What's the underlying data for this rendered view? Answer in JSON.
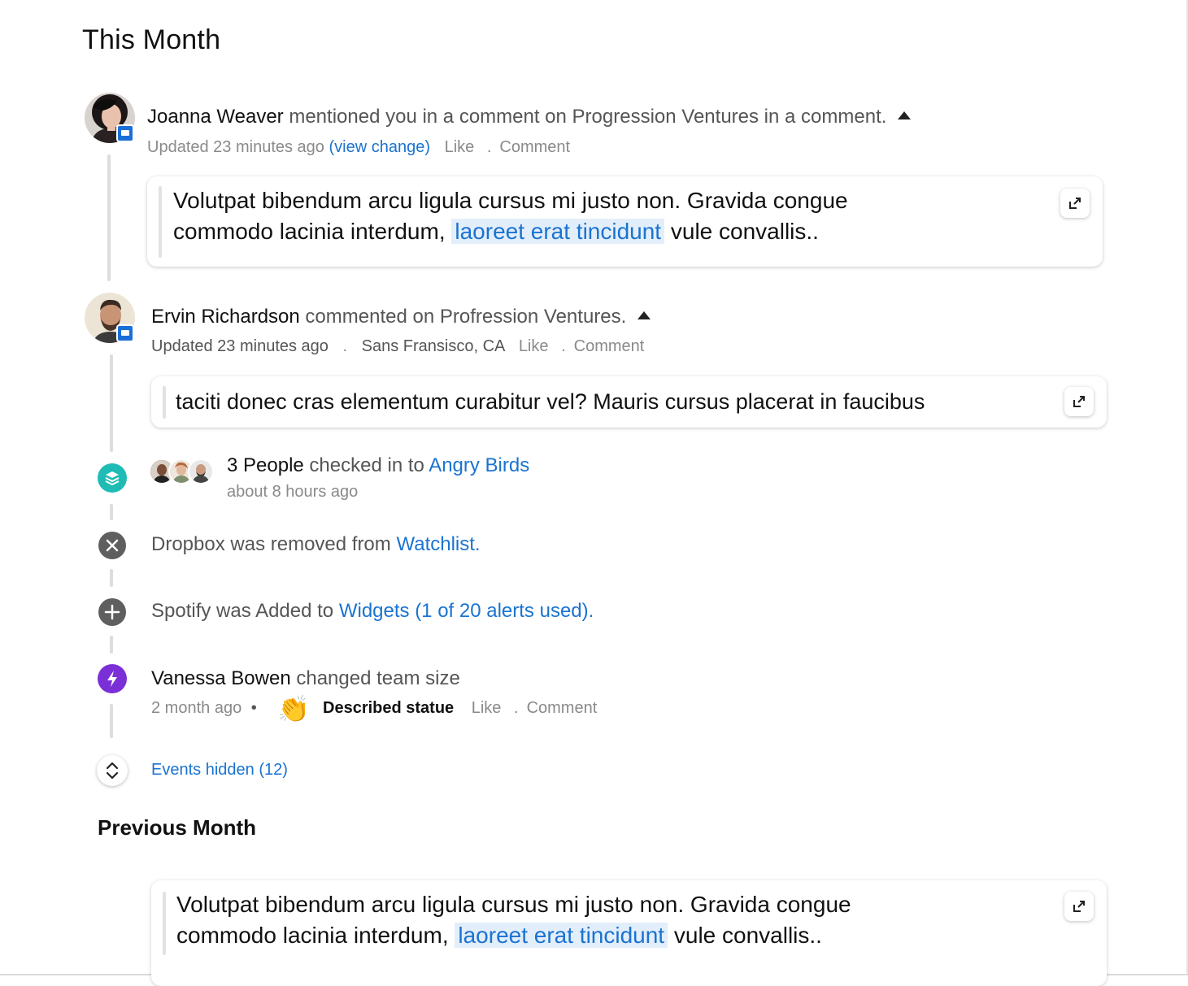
{
  "sections": {
    "this_month": "This Month",
    "previous_month": "Previous Month"
  },
  "feed": {
    "joanna": {
      "name": "Joanna Weaver",
      "action": "mentioned you in a comment on Progression Ventures in a comment.",
      "updated": "Updated 23 minutes ago",
      "view_change": "(view change)",
      "like": "Like",
      "dot": ".",
      "comment": "Comment",
      "quote_part1": "Volutpat bibendum arcu ligula cursus mi justo non. Gravida congue",
      "quote_part2": "commodo lacinia interdum,",
      "quote_highlight": "laoreet erat tincidunt",
      "quote_part3": "vule convallis.."
    },
    "ervin": {
      "name": "Ervin Richardson",
      "action": "commented on Profression Ventures.",
      "updated": "Updated 23 minutes ago",
      "dot": ".",
      "location": "Sans Fransisco, CA",
      "like": "Like",
      "comment": "Comment",
      "quote": "taciti donec cras elementum curabitur vel? Mauris cursus placerat in faucibus"
    },
    "checkin": {
      "people": "3 People",
      "action": "checked in to",
      "target": "Angry Birds",
      "time": "about 8 hours ago"
    },
    "removed": {
      "text": "Dropbox was removed from",
      "target": "Watchlist."
    },
    "added": {
      "text": "Spotify was Added to",
      "target": "Widgets (1 of 20 alerts used)."
    },
    "vanessa": {
      "name": "Vanessa Bowen",
      "action": "changed team size",
      "time": "2 month ago",
      "bullet": "•",
      "clap": "👏",
      "reaction": "Described statue",
      "like": "Like",
      "dot": ".",
      "comment": "Comment"
    },
    "events_hidden": "Events hidden (12)"
  },
  "previous": {
    "quote_part1": "Volutpat bibendum arcu ligula cursus mi justo non. Gravida congue",
    "quote_part2": "commodo lacinia interdum,",
    "quote_highlight": "laoreet erat tincidunt",
    "quote_part3": "vule convallis.."
  },
  "colors": {
    "link": "#1a73d0",
    "highlight_bg": "#e3eefb",
    "badge_blue": "#1a6fd6",
    "teal": "#1fbcb6",
    "gray_icon": "#5f5f5f",
    "purple": "#7b2fd6"
  },
  "icons": {
    "expand": "expand-icon",
    "layers": "layers-icon",
    "close": "close-icon",
    "plus": "plus-icon",
    "bolt": "bolt-icon",
    "chevron": "chevron-up-down-icon",
    "caret": "caret-up-icon",
    "comment_badge": "comment-badge-icon"
  }
}
